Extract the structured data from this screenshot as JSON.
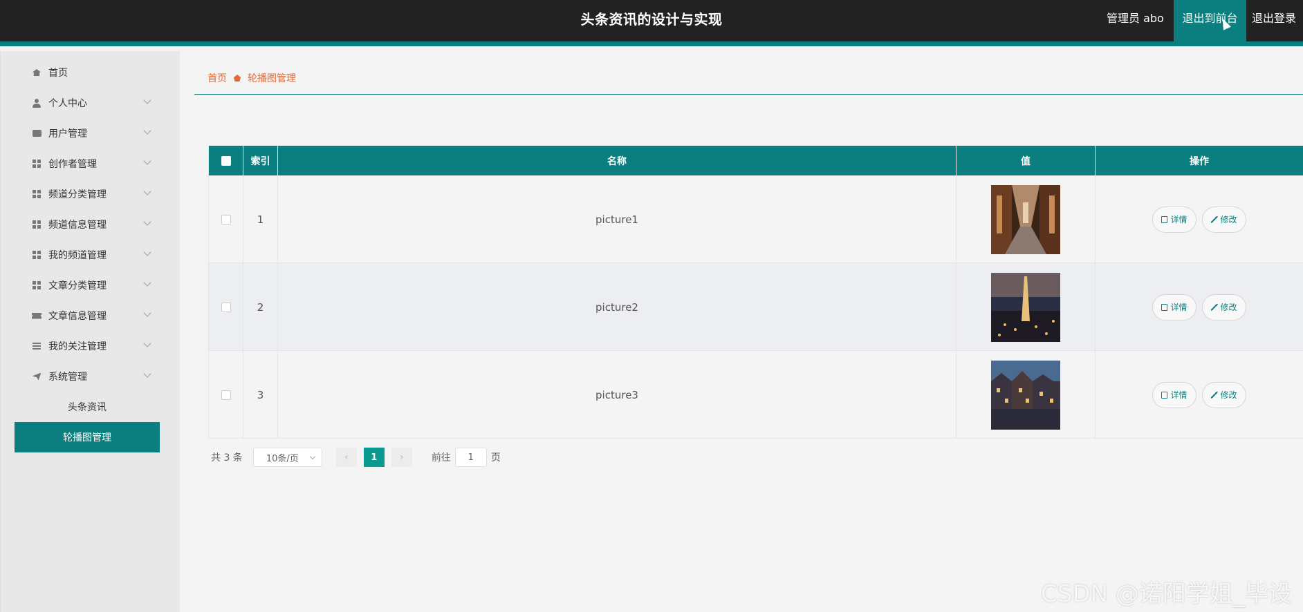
{
  "header": {
    "title": "头条资讯的设计与实现",
    "admin": "管理员 abo",
    "front_btn": "退出到前台",
    "logout_btn": "退出登录"
  },
  "sidebar": {
    "items": [
      {
        "label": "首页",
        "icon": "home-icon"
      },
      {
        "label": "个人中心",
        "icon": "user-icon"
      },
      {
        "label": "用户管理",
        "icon": "chat-icon"
      },
      {
        "label": "创作者管理",
        "icon": "grid-icon"
      },
      {
        "label": "频道分类管理",
        "icon": "grid-icon"
      },
      {
        "label": "频道信息管理",
        "icon": "grid-icon"
      },
      {
        "label": "我的频道管理",
        "icon": "grid-icon"
      },
      {
        "label": "文章分类管理",
        "icon": "grid-icon"
      },
      {
        "label": "文章信息管理",
        "icon": "ticket-icon"
      },
      {
        "label": "我的关注管理",
        "icon": "list-icon"
      },
      {
        "label": "系统管理",
        "icon": "plane-icon"
      }
    ],
    "sub_items": [
      {
        "label": "头条资讯"
      },
      {
        "label": "轮播图管理"
      }
    ]
  },
  "breadcrumb": {
    "home": "首页",
    "current": "轮播图管理"
  },
  "table": {
    "columns": [
      "索引",
      "名称",
      "值",
      "操作"
    ],
    "rows": [
      {
        "index": "1",
        "name": "picture1",
        "image": "library-aisle-image"
      },
      {
        "index": "2",
        "name": "picture2",
        "image": "city-night-image"
      },
      {
        "index": "3",
        "name": "picture3",
        "image": "canal-houses-image"
      }
    ],
    "detail_label": "详情",
    "edit_label": "修改"
  },
  "pagination": {
    "total": "共 3 条",
    "page_size": "10条/页",
    "current_page": "1",
    "goto_label": "前往",
    "goto_value": "1",
    "page_suffix": "页"
  },
  "watermark": "CSDN @诺阳学姐_毕设",
  "colors": {
    "accent": "#0b7f7f",
    "header_bg": "#222222",
    "breadcrumb": "#e06a3a"
  }
}
